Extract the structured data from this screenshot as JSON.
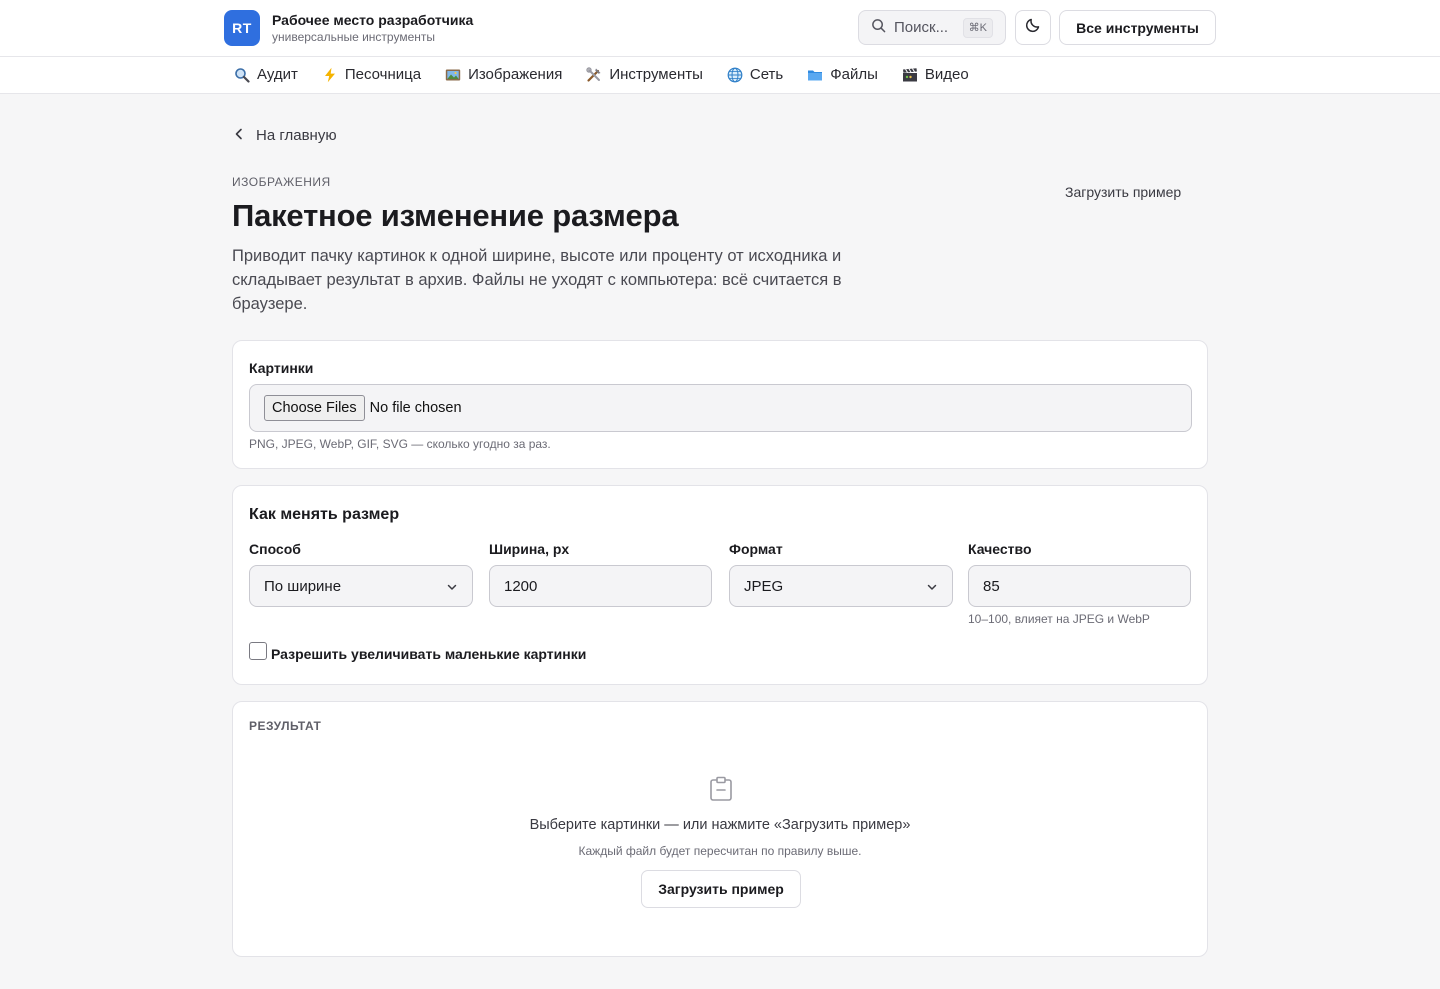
{
  "app": {
    "logo_text": "RT",
    "title": "Рабочее место разработчика",
    "subtitle": "универсальные инструменты",
    "accent_color": "#2f6fdf"
  },
  "header": {
    "search_placeholder": "Поиск...",
    "search_shortcut": "⌘K",
    "theme_icon": "moon-icon",
    "all_tools_label": "Все инструменты"
  },
  "nav": {
    "items": [
      {
        "label": "Аудит",
        "icon": "magnifier-icon"
      },
      {
        "label": "Песочница",
        "icon": "lightning-icon"
      },
      {
        "label": "Изображения",
        "icon": "picture-icon"
      },
      {
        "label": "Инструменты",
        "icon": "tools-icon"
      },
      {
        "label": "Сеть",
        "icon": "globe-icon"
      },
      {
        "label": "Файлы",
        "icon": "folder-icon"
      },
      {
        "label": "Видео",
        "icon": "clapper-icon"
      }
    ]
  },
  "page": {
    "back_label": "На главную",
    "eyebrow": "ИЗОБРАЖЕНИЯ",
    "load_example_link": "Загрузить пример",
    "title": "Пакетное изменение размера",
    "description": "Приводит пачку картинок к одной ширине, высоте или проценту от исходника и складывает результат в архив. Файлы не уходят с компьютера: всё считается в браузере."
  },
  "images_card": {
    "label": "Картинки",
    "choose_button": "Choose Files",
    "no_file_text": "No file chosen",
    "hint": "PNG, JPEG, WebP, GIF, SVG — сколько угодно за раз."
  },
  "resize_card": {
    "title": "Как менять размер",
    "method": {
      "label": "Способ",
      "value": "По ширине"
    },
    "width": {
      "label": "Ширина, px",
      "value": "1200"
    },
    "format": {
      "label": "Формат",
      "value": "JPEG"
    },
    "quality": {
      "label": "Качество",
      "value": "85",
      "hint": "10–100, влияет на JPEG и WebP"
    },
    "upscale": {
      "label": "Разрешить увеличивать маленькие картинки",
      "checked": false
    }
  },
  "result_card": {
    "label": "РЕЗУЛЬТАТ",
    "empty_title": "Выберите картинки — или нажмите «Загрузить пример»",
    "empty_sub": "Каждый файл будет пересчитан по правилу выше.",
    "load_button": "Загрузить пример"
  }
}
